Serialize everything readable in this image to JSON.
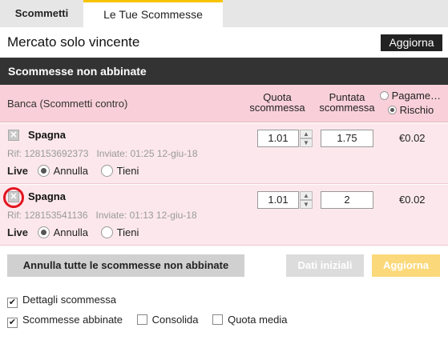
{
  "tabs": [
    {
      "label": "Scommetti",
      "active": false
    },
    {
      "label": "Le Tue Scommesse",
      "active": true
    }
  ],
  "market": {
    "title": "Mercato solo vincente",
    "refresh_label": "Aggiorna"
  },
  "section": {
    "title": "Scommesse non abbinate"
  },
  "header": {
    "side_label": "Banca (Scommetti contro)",
    "odds_col": [
      "Quota",
      "scommessa"
    ],
    "stake_col": [
      "Puntata",
      "scommessa"
    ],
    "payout_option": "Pagame…",
    "risk_option": "Rischio",
    "selected": "risk"
  },
  "bets": [
    {
      "selection": "Spagna",
      "ref": "Rif: 128153692373",
      "sent": "Inviate: 01:25 12-giu-18",
      "live_label": "Live",
      "option_cancel": "Annulla",
      "option_keep": "Tieni",
      "selected_option": "cancel",
      "odds": "1.01",
      "stake": "1.75",
      "liability": "€0.02",
      "highlighted": false
    },
    {
      "selection": "Spagna",
      "ref": "Rif: 128153541136",
      "sent": "Inviate: 01:13 12-giu-18",
      "live_label": "Live",
      "option_cancel": "Annulla",
      "option_keep": "Tieni",
      "selected_option": "cancel",
      "odds": "1.01",
      "stake": "2",
      "liability": "€0.02",
      "highlighted": true
    }
  ],
  "actions": {
    "cancel_all": "Annulla tutte le scommesse non abbinate",
    "initial_data": "Dati iniziali",
    "refresh": "Aggiorna"
  },
  "options": {
    "bet_details": {
      "label": "Dettagli scommessa",
      "checked": true
    },
    "matched_bets": {
      "label": "Scommesse abbinate",
      "checked": true
    },
    "consolidate": {
      "label": "Consolida",
      "checked": false
    },
    "average_odds": {
      "label": "Quota media",
      "checked": false
    }
  },
  "colors": {
    "accent_tab": "#f7c400",
    "section_bar": "#333333",
    "lay_header": "#f9d0d9",
    "lay_row": "#fce8ec",
    "highlight_circle": "#e3131f",
    "refresh_button": "#fbd97a"
  },
  "icons": {
    "remove_bet": "close-x-icon",
    "spin_up": "chevron-up-icon",
    "spin_down": "chevron-down-icon"
  }
}
